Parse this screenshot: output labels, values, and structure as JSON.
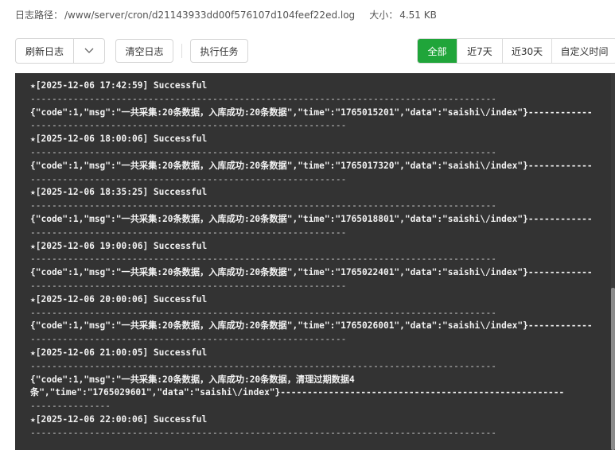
{
  "info": {
    "path_label": "日志路径：",
    "path_value": "/www/server/cron/d21143933dd00f576107d104feef22ed.log",
    "size_label": "大小：",
    "size_value": "4.51 KB"
  },
  "toolbar": {
    "refresh_label": "刷新日志",
    "clear_label": "清空日志",
    "run_label": "执行任务"
  },
  "filters": [
    "全部",
    "近7天",
    "近30天",
    "自定义时间"
  ],
  "log": {
    "dash_line": "---------------------------------------------------------------------------------------",
    "entries": [
      {
        "header": "★[2025-12-06 17:42:59] Successful",
        "body": "{\"code\":1,\"msg\":\"一共采集:20条数据，入库成功:20条数据\",\"time\":\"1765015201\",\"data\":\"saishi\\/index\"}------------",
        "tail": "-----------------------------------------------------------"
      },
      {
        "header": "★[2025-12-06 18:00:06] Successful",
        "body": "{\"code\":1,\"msg\":\"一共采集:20条数据，入库成功:20条数据\",\"time\":\"1765017320\",\"data\":\"saishi\\/index\"}------------",
        "tail": "-----------------------------------------------------------"
      },
      {
        "header": "★[2025-12-06 18:35:25] Successful",
        "body": "{\"code\":1,\"msg\":\"一共采集:20条数据，入库成功:20条数据\",\"time\":\"1765018801\",\"data\":\"saishi\\/index\"}------------",
        "tail": "-----------------------------------------------------------"
      },
      {
        "header": "★[2025-12-06 19:00:06] Successful",
        "body": "{\"code\":1,\"msg\":\"一共采集:20条数据，入库成功:20条数据\",\"time\":\"1765022401\",\"data\":\"saishi\\/index\"}------------",
        "tail": "-----------------------------------------------------------"
      },
      {
        "header": "★[2025-12-06 20:00:06] Successful",
        "body": "{\"code\":1,\"msg\":\"一共采集:20条数据，入库成功:20条数据\",\"time\":\"1765026001\",\"data\":\"saishi\\/index\"}------------",
        "tail": "-----------------------------------------------------------"
      },
      {
        "header": "★[2025-12-06 21:00:05] Successful",
        "body": "{\"code\":1,\"msg\":\"一共采集:20条数据，入库成功:20条数据，清理过期数据4",
        "tail": "条\",\"time\":\"1765029601\",\"data\":\"saishi\\/index\"}-----------------------------------------------------",
        "tail2": "---------------"
      },
      {
        "header": "★[2025-12-06 22:00:06] Successful",
        "body": "",
        "tail": ""
      }
    ]
  }
}
